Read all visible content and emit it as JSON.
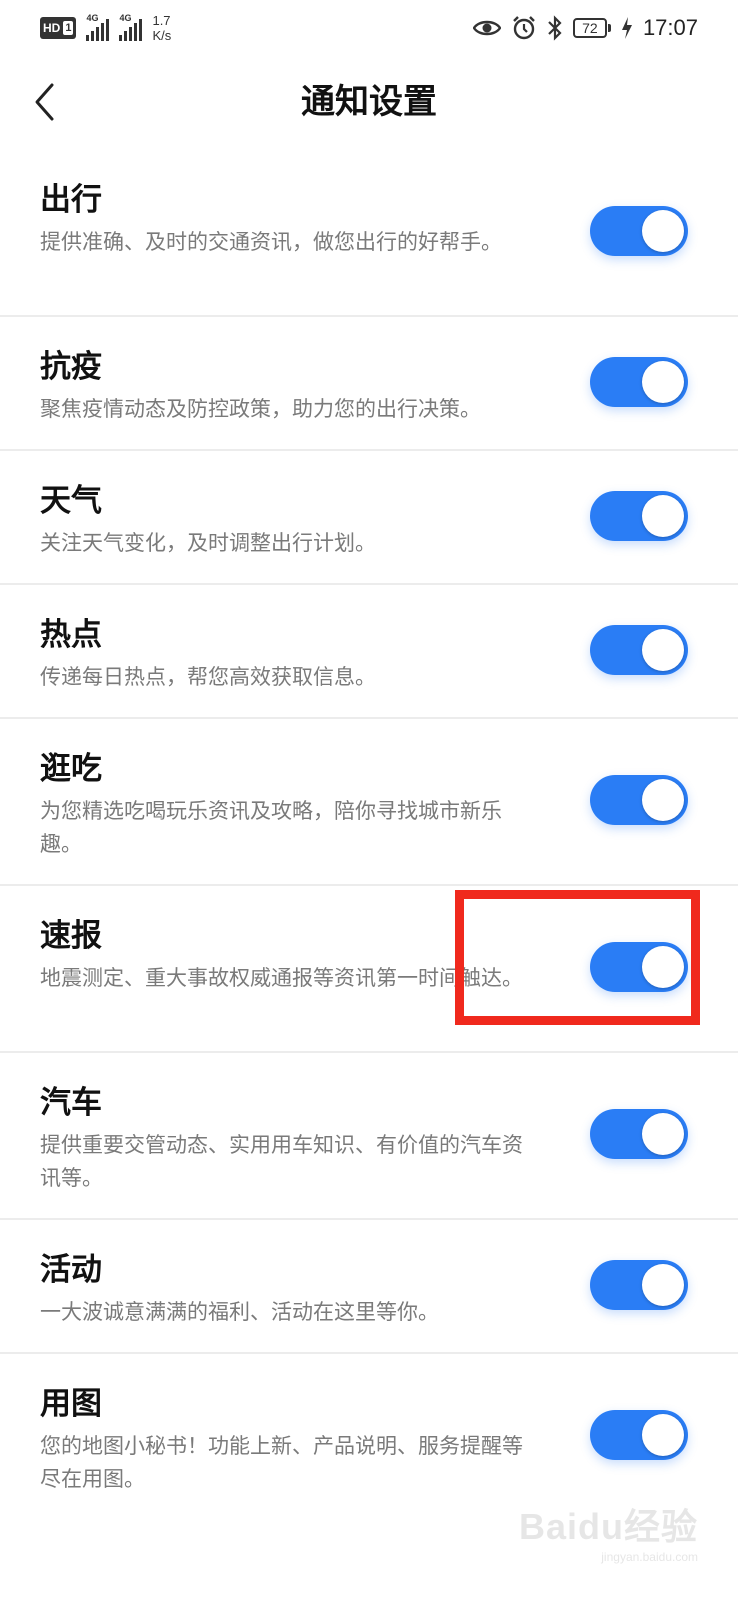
{
  "status_bar": {
    "hd_label": "HD",
    "hd_num": "1",
    "sim1_tag": "4G",
    "sim2_tag": "4G",
    "speed_value": "1.7",
    "speed_unit": "K/s",
    "battery": "72",
    "time": "17:07",
    "icons": [
      "eye-icon",
      "alarm-icon",
      "bluetooth-icon",
      "charging-icon"
    ]
  },
  "header": {
    "title": "通知设置",
    "back_icon": "chevron-left-icon"
  },
  "settings": [
    {
      "title": "出行",
      "desc": "提供准确、及时的交通资讯，做您出行的好帮手。",
      "enabled": true
    },
    {
      "title": "抗疫",
      "desc": "聚焦疫情动态及防控政策，助力您的出行决策。",
      "enabled": true
    },
    {
      "title": "天气",
      "desc": "关注天气变化，及时调整出行计划。",
      "enabled": true
    },
    {
      "title": "热点",
      "desc": "传递每日热点，帮您高效获取信息。",
      "enabled": true
    },
    {
      "title": "逛吃",
      "desc": "为您精选吃喝玩乐资讯及攻略，陪你寻找城市新乐趣。",
      "enabled": true
    },
    {
      "title": "速报",
      "desc": "地震测定、重大事故权威通报等资讯第一时间触达。",
      "enabled": true
    },
    {
      "title": "汽车",
      "desc": "提供重要交管动态、实用用车知识、有价值的汽车资讯等。",
      "enabled": true
    },
    {
      "title": "活动",
      "desc": "一大波诚意满满的福利、活动在这里等你。",
      "enabled": true
    },
    {
      "title": "用图",
      "desc": "您的地图小秘书！功能上新、产品说明、服务提醒等尽在用图。",
      "enabled": true
    }
  ],
  "colors": {
    "toggle_on": "#2a7df5",
    "highlight": "#f0291d"
  },
  "watermark": {
    "main": "Baidu经验",
    "sub": "jingyan.baidu.com"
  }
}
